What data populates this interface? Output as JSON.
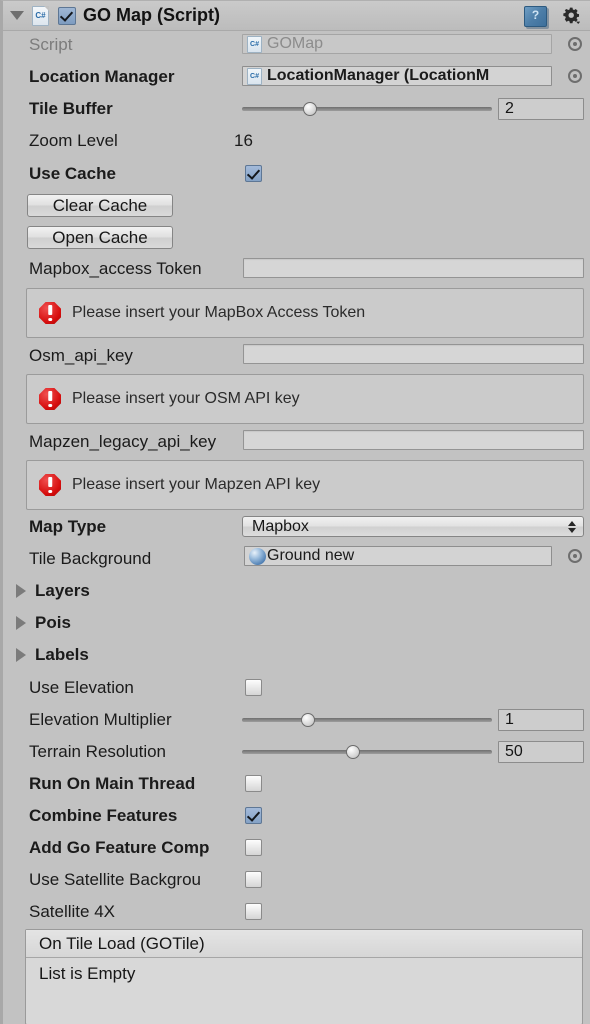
{
  "header": {
    "title": "GO Map (Script)",
    "foldout_icon": "foldout-triangle-down",
    "script_icon_label": "C#",
    "enabled": true,
    "help_icon": "help-book-icon",
    "settings_icon": "gear-icon"
  },
  "fields": {
    "script": {
      "label": "Script",
      "value": "GOMap",
      "icon": "cs-script-icon",
      "bold_label": false,
      "disabled": true
    },
    "location_manager": {
      "label": "Location Manager",
      "value": "LocationManager (LocationM",
      "icon": "cs-script-icon",
      "bold_label": true
    },
    "tile_buffer": {
      "label": "Tile Buffer",
      "value": "2",
      "bold_label": true,
      "slider_pct": 26
    },
    "zoom_level": {
      "label": "Zoom Level",
      "value": "16",
      "bold_label": false
    },
    "use_cache": {
      "label": "Use Cache",
      "checked": true,
      "bold_label": true
    },
    "clear_cache_button": {
      "label": "Clear Cache"
    },
    "open_cache_button": {
      "label": "Open Cache"
    },
    "mapbox_token": {
      "label": "Mapbox_access Token",
      "value": "",
      "bold_label": false
    },
    "mapbox_help": {
      "message": "Please insert your MapBox Access Token",
      "icon": "error-icon"
    },
    "osm_key": {
      "label": "Osm_api_key",
      "value": "",
      "bold_label": false
    },
    "osm_help": {
      "message": "Please insert your OSM API key",
      "icon": "error-icon"
    },
    "mapzen_key": {
      "label": "Mapzen_legacy_api_key",
      "value": "",
      "bold_label": false
    },
    "mapzen_help": {
      "message": "Please insert your Mapzen API key",
      "icon": "error-icon"
    },
    "map_type": {
      "label": "Map Type",
      "value": "Mapbox",
      "bold_label": true,
      "options": [
        "Mapbox"
      ]
    },
    "tile_background": {
      "label": "Tile Background",
      "value": "Ground new",
      "icon": "material-sphere-icon",
      "bold_label": false
    },
    "layers": {
      "label": "Layers",
      "expanded": false,
      "bold_label": true
    },
    "pois": {
      "label": "Pois",
      "expanded": false,
      "bold_label": true
    },
    "labels": {
      "label": "Labels",
      "expanded": false,
      "bold_label": true
    },
    "use_elevation": {
      "label": "Use Elevation",
      "checked": false,
      "bold_label": false
    },
    "elevation_multiplier": {
      "label": "Elevation Multiplier",
      "value": "1",
      "bold_label": false,
      "slider_pct": 25
    },
    "terrain_resolution": {
      "label": "Terrain Resolution",
      "value": "50",
      "bold_label": false,
      "slider_pct": 44
    },
    "run_on_main_thread": {
      "label": "Run On Main Thread",
      "checked": false,
      "bold_label": true
    },
    "combine_features": {
      "label": "Combine Features",
      "checked": true,
      "bold_label": true
    },
    "add_go_feature_component": {
      "label": "Add Go Feature Comp",
      "checked": false,
      "bold_label": true
    },
    "use_satellite_background": {
      "label": "Use Satellite Backgrou",
      "checked": false,
      "bold_label": false
    },
    "satellite_4x": {
      "label": "Satellite 4X",
      "checked": false,
      "bold_label": false
    }
  },
  "event_list": {
    "header": "On Tile Load (GOTile)",
    "empty_text": "List is Empty"
  },
  "colors": {
    "background": "#c2c2c2",
    "field": "#d3d3d3",
    "accent_checkbox": "#84a2c6",
    "error": "#d60d0d",
    "text": "#1b1b1b",
    "text_dim": "#7c7c7c"
  }
}
